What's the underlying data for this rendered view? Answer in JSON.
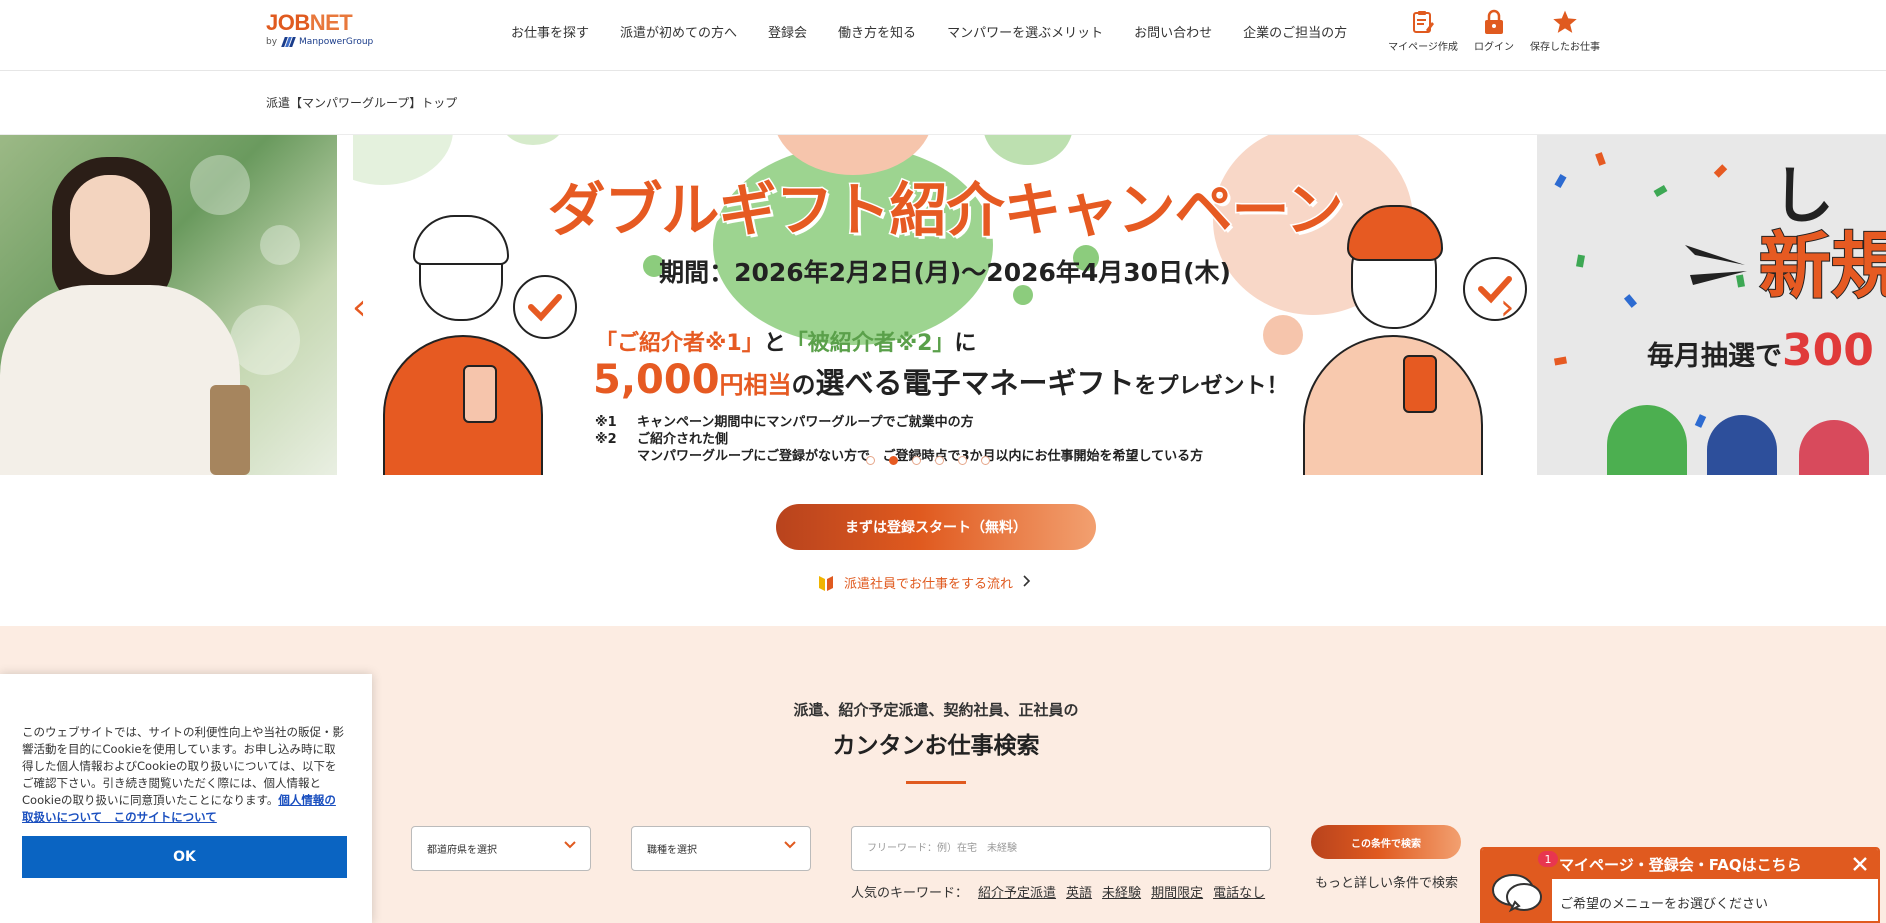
{
  "logo": {
    "main_a": "JOB",
    "main_b": "NET",
    "by": "by",
    "group": "ManpowerGroup"
  },
  "nav": [
    "お仕事を探す",
    "派遣が初めての方へ",
    "登録会",
    "働き方を知る",
    "マンパワーを選ぶメリット",
    "お問い合わせ",
    "企業のご担当の方"
  ],
  "header_icons": [
    {
      "label": "マイページ作成",
      "icon": "clipboard-icon"
    },
    {
      "label": "ログイン",
      "icon": "lock-icon"
    },
    {
      "label": "保存したお仕事",
      "icon": "star-icon"
    }
  ],
  "breadcrumb": "派遣【マンパワーグループ】トップ",
  "banner": {
    "title": "ダブルギフト紹介キャンペーン",
    "period": "期間：2026年2月2日(月)〜2026年4月30日(木)",
    "line1_a": "「ご紹介者※1」",
    "line1_b": "と",
    "line1_c": "「被紹介者※2」",
    "line1_d": "に",
    "amount": "5,000",
    "yen": "円相当",
    "no": "の",
    "gift": "選べる電子マネーギフト",
    "present": "をプレゼント！",
    "notes": [
      {
        "key": "※1",
        "text": "キャンペーン期間中にマンパワーグループでご就業中の方"
      },
      {
        "key": "※2",
        "text": "ご紹介された側"
      },
      {
        "key": "",
        "text": "マンパワーグループにご登録がない方で、ご登録時点で3か月以内にお仕事開始を希望している方"
      }
    ]
  },
  "right_banner": {
    "top": "し",
    "big": "新規",
    "mid_a": "毎月抽選で",
    "mid_num": "300"
  },
  "carousel": {
    "slide_count": 6,
    "active_index": 1,
    "prev": "‹",
    "next": "›"
  },
  "cta": "まずは登録スタート（無料）",
  "flow_link": "派遣社員でお仕事をする流れ",
  "search": {
    "subtitle": "派遣、紹介予定派遣、契約社員、正社員の",
    "title": "カンタンお仕事検索",
    "prefecture": "都道府県を選択",
    "job_type": "職種を選択",
    "freeword_placeholder": "フリーワード：例）在宅　未経験",
    "button": "この条件で検索",
    "more": "もっと詳しい条件で検索",
    "keywords_label": "人気のキーワード：",
    "keywords": [
      "紹介予定派遣",
      "英語",
      "未経験",
      "期間限定",
      "電話なし"
    ]
  },
  "cookie": {
    "text": "このウェブサイトでは、サイトの利便性向上や当社の販促・影響活動を目的にCookieを使用しています。お申し込み時に取得した個人情報およびCookieの取り扱いについては、以下をご確認下さい。引き続き閲覧いただく際には、個人情報とCookieの取り扱いに同意頂いたことになります。",
    "link": "個人情報の取扱いについて　このサイトについて",
    "ok": "OK"
  },
  "chat": {
    "badge": "1",
    "header": "マイページ・登録会・FAQはこちら",
    "body": "ご希望のメニューをお選びください"
  },
  "colors": {
    "brand_orange": "#e05a1f",
    "cookie_blue": "#0a64c2",
    "search_bg": "#fcece2"
  }
}
